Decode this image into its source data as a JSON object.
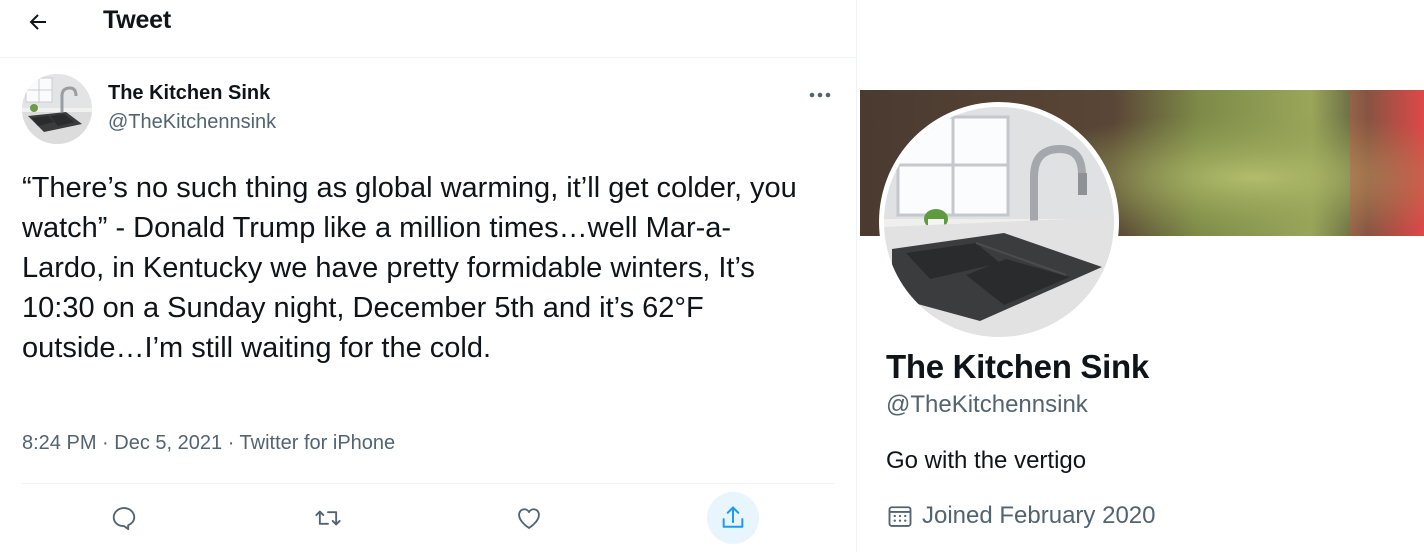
{
  "header": {
    "back_icon": "back-arrow-icon",
    "title": "Tweet"
  },
  "tweet": {
    "author_name": "The Kitchen Sink",
    "author_handle": "@TheKitchennsink",
    "more_icon": "more-options-icon",
    "text": "“There’s no such thing as global warming, it’ll get colder, you watch” - Donald Trump like a million times…well Mar-a-Lardo, in Kentucky we have pretty formidable winters, It’s 10:30 on a Sunday night, December 5th and it’s 62°F outside…I’m still waiting for the cold.",
    "time": "8:24 PM",
    "date": "Dec 5, 2021",
    "source": "Twitter for iPhone",
    "separator": "·"
  },
  "actions": [
    {
      "icon": "reply-icon"
    },
    {
      "icon": "retweet-icon"
    },
    {
      "icon": "like-icon"
    },
    {
      "icon": "share-icon"
    }
  ],
  "profile": {
    "name": "The Kitchen Sink",
    "handle": "@TheKitchennsink",
    "bio": "Go with the vertigo",
    "joined": "Joined February 2020",
    "joined_icon": "calendar-icon"
  },
  "colors": {
    "text_primary": "#0f1419",
    "text_secondary": "#536471",
    "accent": "#1d9bf0",
    "divider": "#eff3f4"
  }
}
